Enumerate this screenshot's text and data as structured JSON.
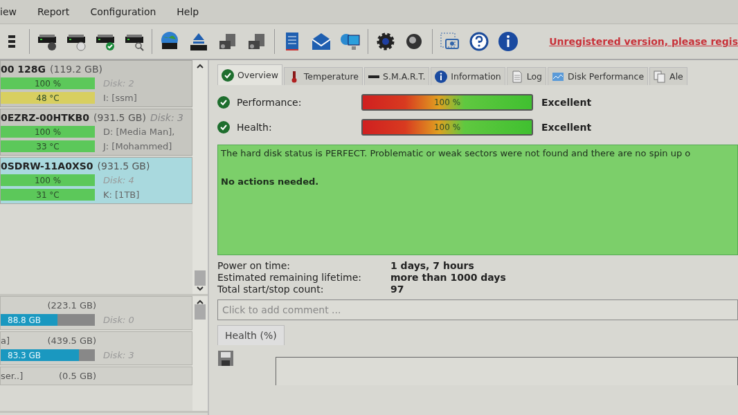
{
  "menu": [
    "iew",
    "Report",
    "Configuration",
    "Help"
  ],
  "toolbar": {
    "link": "Unregistered version, please regis"
  },
  "disks": [
    {
      "title": "00 128G",
      "size": "(119.2 GB)",
      "selected": false,
      "rows": [
        {
          "value": "100 %",
          "level": 1,
          "color": "#5cc85a",
          "note": "Disk: 2",
          "kind": "disk"
        },
        {
          "value": "48 °C",
          "level": 1,
          "color": "#d8cf60",
          "note": "I: [ssm]",
          "kind": "drive"
        }
      ]
    },
    {
      "title": "0EZRZ-00HTKB0",
      "size": "(931.5 GB)",
      "tag": "Disk: 3",
      "selected": false,
      "rows": [
        {
          "value": "100 %",
          "level": 1,
          "color": "#5cc85a",
          "note": "D: [Media Man],",
          "kind": "drive"
        },
        {
          "value": "33 °C",
          "level": 1,
          "color": "#5cc85a",
          "note": "J: [Mohammed]",
          "kind": "drive"
        }
      ]
    },
    {
      "title": "0SDRW-11A0XS0",
      "size": "(931.5 GB)",
      "selected": true,
      "rows": [
        {
          "value": "100 %",
          "level": 1,
          "color": "#5cc85a",
          "note": "Disk: 4",
          "kind": "disk"
        },
        {
          "value": "31 °C",
          "level": 1,
          "color": "#5cc85a",
          "note": "K: [1TB]",
          "kind": "drive"
        }
      ]
    }
  ],
  "partitions": [
    {
      "size": "(223.1 GB)",
      "value": "88.8 GB",
      "level": 0.6,
      "note": "Disk: 0"
    },
    {
      "name": "a]",
      "size": "(439.5 GB)",
      "value": "83.3 GB",
      "level": 0.83,
      "note": "Disk: 3"
    },
    {
      "name": "ser..]",
      "size": "(0.5 GB)"
    }
  ],
  "tabs": [
    {
      "label": "Overview",
      "selected": true
    },
    {
      "label": "Temperature",
      "selected": false
    },
    {
      "label": "S.M.A.R.T.",
      "selected": false
    },
    {
      "label": "Information",
      "selected": false
    },
    {
      "label": "Log",
      "selected": false
    },
    {
      "label": "Disk Performance",
      "selected": false
    },
    {
      "label": "Ale",
      "selected": false
    }
  ],
  "gauges": [
    {
      "label": "Performance:",
      "value": "100 %",
      "level": 1,
      "rating": "Excellent"
    },
    {
      "label": "Health:",
      "value": "100 %",
      "level": 1,
      "rating": "Excellent"
    }
  ],
  "status": {
    "text": "The hard disk status is PERFECT. Problematic or weak sectors were not found and there are no spin up o",
    "action": "No actions needed."
  },
  "details": [
    {
      "label": "Power on time:",
      "value": "1 days, 7 hours"
    },
    {
      "label": "Estimated remaining lifetime:",
      "value": "more than 1000 days"
    },
    {
      "label": "Total start/stop count:",
      "value": "97"
    }
  ],
  "comment": {
    "placeholder": "Click to add comment ..."
  },
  "chart_tab": "Health (%)"
}
